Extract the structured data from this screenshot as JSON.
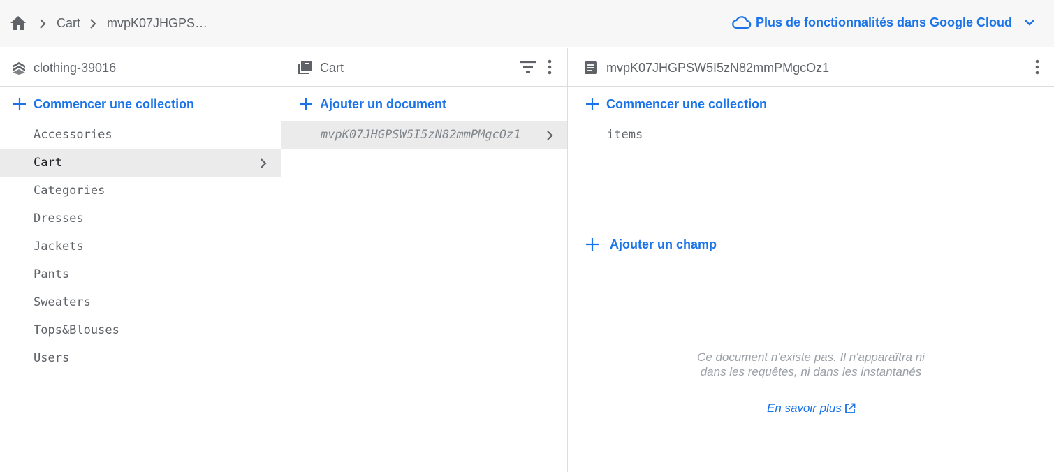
{
  "breadcrumb": {
    "items": [
      "Cart",
      "mvpK07JHGPS…"
    ]
  },
  "cloud_link": {
    "label": "Plus de fonctionnalités dans Google Cloud"
  },
  "colors": {
    "accent": "#1a73e8",
    "selected_bg": "#ebebeb",
    "divider": "#dadce0",
    "topbar_bg": "#f7f7f7"
  },
  "root_panel": {
    "title": "clothing-39016",
    "add_label": "Commencer une collection",
    "collections": [
      "Accessories",
      "Cart",
      "Categories",
      "Dresses",
      "Jackets",
      "Pants",
      "Sweaters",
      "Tops&Blouses",
      "Users"
    ],
    "selected": "Cart"
  },
  "collection_panel": {
    "title": "Cart",
    "add_label": "Ajouter un document",
    "documents": [
      "mvpK07JHGPSW5I5zN82mmPMgcOz1"
    ]
  },
  "document_panel": {
    "title": "mvpK07JHGPSW5I5zN82mmPMgcOz1",
    "add_collection_label": "Commencer une collection",
    "subcollections": [
      "items"
    ],
    "add_field_label": "Ajouter un champ",
    "empty_message": "Ce document n'existe pas. Il n'apparaîtra ni dans les requêtes, ni dans les instantanés",
    "learn_more": "En savoir plus"
  }
}
